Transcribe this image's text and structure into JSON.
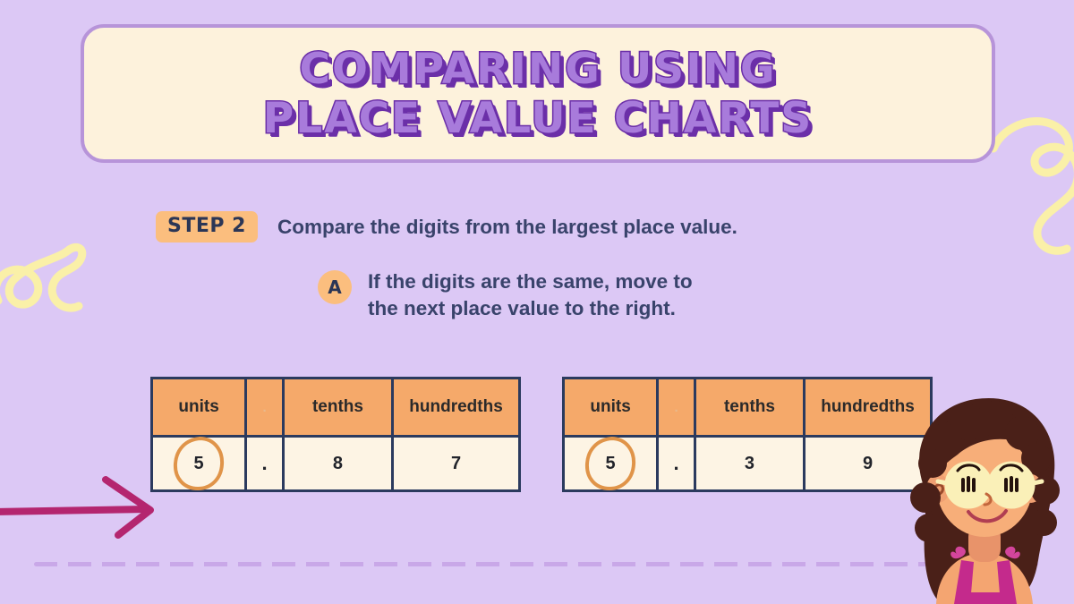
{
  "slide": {
    "background_color": "#DCC8F5",
    "title_lines": [
      "Comparing Using",
      "Place Value Charts"
    ]
  },
  "step": {
    "badge_label": "Step 2",
    "text": "Compare the digits from the largest place value."
  },
  "sub_item": {
    "badge_label": "A",
    "text": "If the digits are the same, move to\nthe next place value to the right."
  },
  "tables": [
    {
      "name": "left-place-value-chart",
      "headers": [
        "units",
        ".",
        "tenths",
        "hundredths"
      ],
      "values": [
        "5",
        ".",
        "8",
        "7"
      ],
      "circled_index": 0,
      "number": "5.87"
    },
    {
      "name": "right-place-value-chart",
      "headers": [
        "units",
        ".",
        "tenths",
        "hundredths"
      ],
      "values": [
        "5",
        ".",
        "3",
        "9"
      ],
      "circled_index": 0,
      "number": "5.39"
    }
  ],
  "decorations": {
    "left_squiggle": "yellow-squiggle-doodle",
    "right_squiggle": "yellow-squiggle-doodle",
    "arrow": "magenta-arrow-doodle",
    "dashed_rule": "dashed-divider",
    "character": "girl-with-glasses-illustration"
  },
  "colors": {
    "background": "#DCC8F5",
    "card_background": "#FDF2DC",
    "card_border": "#B794D9",
    "title_fill": "#A87BDB",
    "title_outline": "#6B2FA8",
    "accent_orange": "#FBBE7E",
    "header_orange": "#F5A96A",
    "cell_cream": "#FDF4E4",
    "table_border": "#2B3A5E",
    "text_navy": "#39436B",
    "circle_mark": "#E09449",
    "arrow_magenta": "#B4266F",
    "doodle_yellow": "#FAF0A8",
    "dash_purple": "#C9A8E8"
  }
}
